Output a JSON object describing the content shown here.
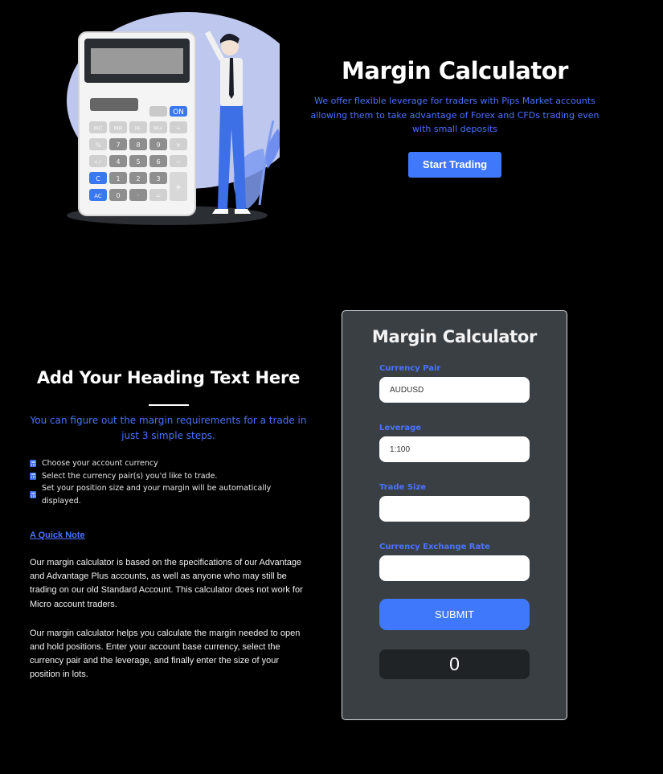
{
  "hero": {
    "title": "Margin Calculator",
    "subtitle": "We offer flexible leverage for traders with Pips Market accounts allowing them to take advantage of Forex and CFDs trading even with small deposits",
    "cta_label": "Start Trading",
    "illustration": {
      "calculator_keys": [
        "MC",
        "MR",
        "M-",
        "M+",
        "÷",
        "%",
        "7",
        "8",
        "9",
        "×",
        "+/-",
        "4",
        "5",
        "6",
        "−",
        "C",
        "1",
        "2",
        "3",
        "+",
        "AC",
        "0",
        "·",
        "="
      ],
      "on_key": "ON",
      "check_key": "✓"
    }
  },
  "info": {
    "heading": "Add Your Heading Text Here",
    "subheading": "You can figure out the margin requirements for a trade in just 3 simple steps.",
    "steps": [
      "Choose your account currency",
      "Select the currency pair(s) you'd like to trade.",
      "Set your position size and your margin will be automatically displayed."
    ],
    "note_link": "A Quick Note",
    "paragraphs": [
      "Our margin calculator is based on the specifications of our Advantage and Advantage Plus accounts, as well as anyone who may still be trading on our old Standard Account. This calculator does not work for Micro account traders.",
      "Our margin calculator helps you calculate the margin needed to open and hold positions. Enter your account base currency, select the currency pair and the leverage, and finally enter the size of your position in lots."
    ]
  },
  "calculator": {
    "title": "Margin Calculator",
    "fields": [
      {
        "label": "Currency Pair",
        "value": "AUDUSD"
      },
      {
        "label": "Leverage",
        "value": "1:100"
      },
      {
        "label": "Trade Size",
        "value": ""
      },
      {
        "label": "Currency Exchange Rate",
        "value": ""
      }
    ],
    "submit_label": "SUBMIT",
    "result": "0"
  },
  "colors": {
    "accent": "#3f78fa",
    "accent_text": "#4a73ff",
    "card_bg": "#3a3f44",
    "result_bg": "#1f2326",
    "page_bg": "#000000"
  }
}
